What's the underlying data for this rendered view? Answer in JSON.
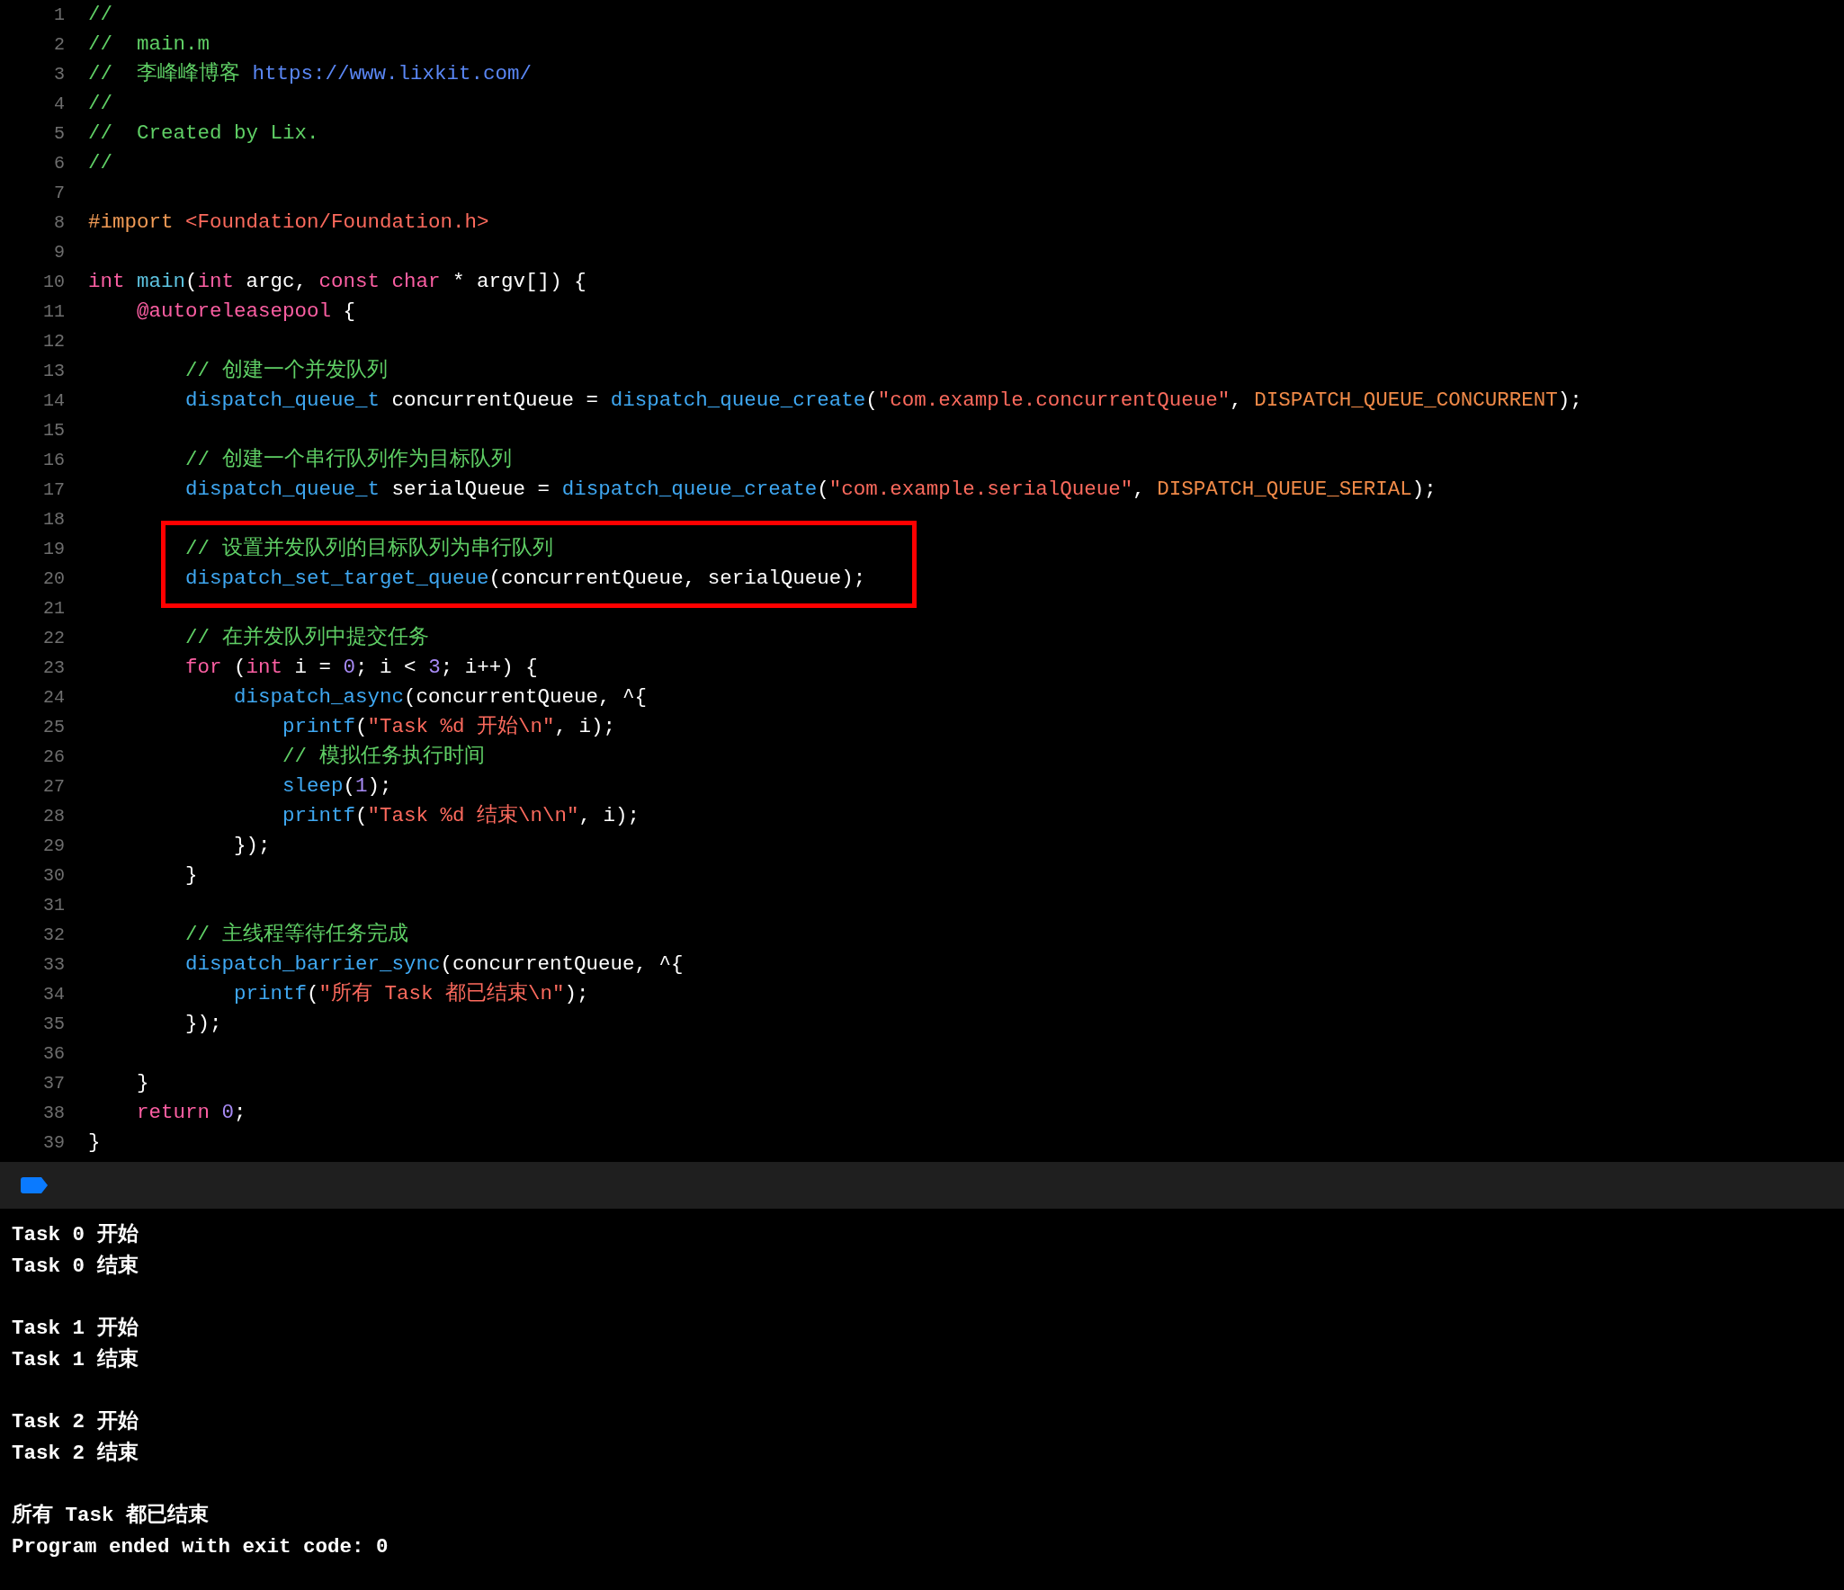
{
  "editor": {
    "lines": [
      {
        "number": "1",
        "tokens": [
          {
            "kind": "comment",
            "text": "//"
          }
        ]
      },
      {
        "number": "2",
        "tokens": [
          {
            "kind": "comment",
            "text": "//  main.m"
          }
        ]
      },
      {
        "number": "3",
        "tokens": [
          {
            "kind": "comment",
            "text": "//  李峰峰博客 "
          },
          {
            "kind": "url",
            "text": "https://www.lixkit.com/"
          }
        ]
      },
      {
        "number": "4",
        "tokens": [
          {
            "kind": "comment",
            "text": "//"
          }
        ]
      },
      {
        "number": "5",
        "tokens": [
          {
            "kind": "comment",
            "text": "//  Created by Lix."
          }
        ]
      },
      {
        "number": "6",
        "tokens": [
          {
            "kind": "comment",
            "text": "//"
          }
        ]
      },
      {
        "number": "7"
      },
      {
        "number": "8",
        "tokens": [
          {
            "kind": "preproc",
            "text": "#import "
          },
          {
            "kind": "string",
            "text": "<Foundation/Foundation.h>"
          }
        ]
      },
      {
        "number": "9"
      },
      {
        "number": "10",
        "tokens": [
          {
            "kind": "keyword",
            "text": "int "
          },
          {
            "kind": "decl",
            "text": "main"
          },
          {
            "kind": "plain",
            "text": "("
          },
          {
            "kind": "keyword",
            "text": "int "
          },
          {
            "kind": "plain",
            "text": "argc, "
          },
          {
            "kind": "keyword",
            "text": "const "
          },
          {
            "kind": "keyword",
            "text": "char "
          },
          {
            "kind": "plain",
            "text": "* argv[]) {"
          }
        ]
      },
      {
        "number": "11",
        "tokens": [
          {
            "kind": "keyword",
            "text": "    @autoreleasepool"
          },
          {
            "kind": "plain",
            "text": " {"
          }
        ]
      },
      {
        "number": "12"
      },
      {
        "number": "13",
        "tokens": [
          {
            "kind": "comment",
            "text": "        // 创建一个并发队列"
          }
        ]
      },
      {
        "number": "14",
        "tokens": [
          {
            "kind": "function",
            "text": "        dispatch_queue_t"
          },
          {
            "kind": "plain",
            "text": " concurrentQueue = "
          },
          {
            "kind": "function",
            "text": "dispatch_queue_create"
          },
          {
            "kind": "plain",
            "text": "("
          },
          {
            "kind": "string",
            "text": "\"com.example.concurrentQueue\""
          },
          {
            "kind": "plain",
            "text": ", "
          },
          {
            "kind": "constant",
            "text": "DISPATCH_QUEUE_CONCURRENT"
          },
          {
            "kind": "plain",
            "text": ");"
          }
        ]
      },
      {
        "number": "15"
      },
      {
        "number": "16",
        "tokens": [
          {
            "kind": "comment",
            "text": "        // 创建一个串行队列作为目标队列"
          }
        ]
      },
      {
        "number": "17",
        "tokens": [
          {
            "kind": "function",
            "text": "        dispatch_queue_t"
          },
          {
            "kind": "plain",
            "text": " serialQueue = "
          },
          {
            "kind": "function",
            "text": "dispatch_queue_create"
          },
          {
            "kind": "plain",
            "text": "("
          },
          {
            "kind": "string",
            "text": "\"com.example.serialQueue\""
          },
          {
            "kind": "plain",
            "text": ", "
          },
          {
            "kind": "constant",
            "text": "DISPATCH_QUEUE_SERIAL"
          },
          {
            "kind": "plain",
            "text": ");"
          }
        ]
      },
      {
        "number": "18"
      },
      {
        "number": "19",
        "boxed": true,
        "tokens": [
          {
            "kind": "comment",
            "text": "        // 设置并发队列的目标队列为串行队列"
          }
        ]
      },
      {
        "number": "20",
        "boxed": true,
        "tokens": [
          {
            "kind": "function",
            "text": "        dispatch_set_target_queue"
          },
          {
            "kind": "plain",
            "text": "(concurrentQueue, serialQueue);"
          }
        ]
      },
      {
        "number": "21"
      },
      {
        "number": "22",
        "tokens": [
          {
            "kind": "comment",
            "text": "        // 在并发队列中提交任务"
          }
        ]
      },
      {
        "number": "23",
        "tokens": [
          {
            "kind": "keyword",
            "text": "        for"
          },
          {
            "kind": "plain",
            "text": " ("
          },
          {
            "kind": "keyword",
            "text": "int"
          },
          {
            "kind": "plain",
            "text": " i = "
          },
          {
            "kind": "number",
            "text": "0"
          },
          {
            "kind": "plain",
            "text": "; i < "
          },
          {
            "kind": "number",
            "text": "3"
          },
          {
            "kind": "plain",
            "text": "; i++) {"
          }
        ]
      },
      {
        "number": "24",
        "tokens": [
          {
            "kind": "function",
            "text": "            dispatch_async"
          },
          {
            "kind": "plain",
            "text": "(concurrentQueue, ^{"
          }
        ]
      },
      {
        "number": "25",
        "tokens": [
          {
            "kind": "function",
            "text": "                printf"
          },
          {
            "kind": "plain",
            "text": "("
          },
          {
            "kind": "string",
            "text": "\"Task %d 开始\\n\""
          },
          {
            "kind": "plain",
            "text": ", i);"
          }
        ]
      },
      {
        "number": "26",
        "tokens": [
          {
            "kind": "comment",
            "text": "                // 模拟任务执行时间"
          }
        ]
      },
      {
        "number": "27",
        "tokens": [
          {
            "kind": "function",
            "text": "                sleep"
          },
          {
            "kind": "plain",
            "text": "("
          },
          {
            "kind": "number",
            "text": "1"
          },
          {
            "kind": "plain",
            "text": ");"
          }
        ]
      },
      {
        "number": "28",
        "tokens": [
          {
            "kind": "function",
            "text": "                printf"
          },
          {
            "kind": "plain",
            "text": "("
          },
          {
            "kind": "string",
            "text": "\"Task %d 结束\\n\\n\""
          },
          {
            "kind": "plain",
            "text": ", i);"
          }
        ]
      },
      {
        "number": "29",
        "tokens": [
          {
            "kind": "plain",
            "text": "            });"
          }
        ]
      },
      {
        "number": "30",
        "tokens": [
          {
            "kind": "plain",
            "text": "        }"
          }
        ]
      },
      {
        "number": "31"
      },
      {
        "number": "32",
        "tokens": [
          {
            "kind": "comment",
            "text": "        // 主线程等待任务完成"
          }
        ]
      },
      {
        "number": "33",
        "tokens": [
          {
            "kind": "function",
            "text": "        dispatch_barrier_sync"
          },
          {
            "kind": "plain",
            "text": "(concurrentQueue, ^{"
          }
        ]
      },
      {
        "number": "34",
        "tokens": [
          {
            "kind": "function",
            "text": "            printf"
          },
          {
            "kind": "plain",
            "text": "("
          },
          {
            "kind": "string",
            "text": "\"所有 Task 都已结束\\n\""
          },
          {
            "kind": "plain",
            "text": ");"
          }
        ]
      },
      {
        "number": "35",
        "tokens": [
          {
            "kind": "plain",
            "text": "        });"
          }
        ]
      },
      {
        "number": "36"
      },
      {
        "number": "37",
        "tokens": [
          {
            "kind": "plain",
            "text": "    }"
          }
        ]
      },
      {
        "number": "38",
        "tokens": [
          {
            "kind": "keyword",
            "text": "    return "
          },
          {
            "kind": "number",
            "text": "0"
          },
          {
            "kind": "plain",
            "text": ";"
          }
        ]
      },
      {
        "number": "39",
        "tokens": [
          {
            "kind": "plain",
            "text": "}"
          }
        ]
      }
    ]
  },
  "console": {
    "output": [
      [
        "Task 0 开始",
        "Task 0 结束"
      ],
      [
        "Task 1 开始",
        "Task 1 结束"
      ],
      [
        "Task 2 开始",
        "Task 2 结束"
      ],
      [
        "所有 Task 都已结束",
        "Program ended with exit code: 0"
      ]
    ]
  }
}
